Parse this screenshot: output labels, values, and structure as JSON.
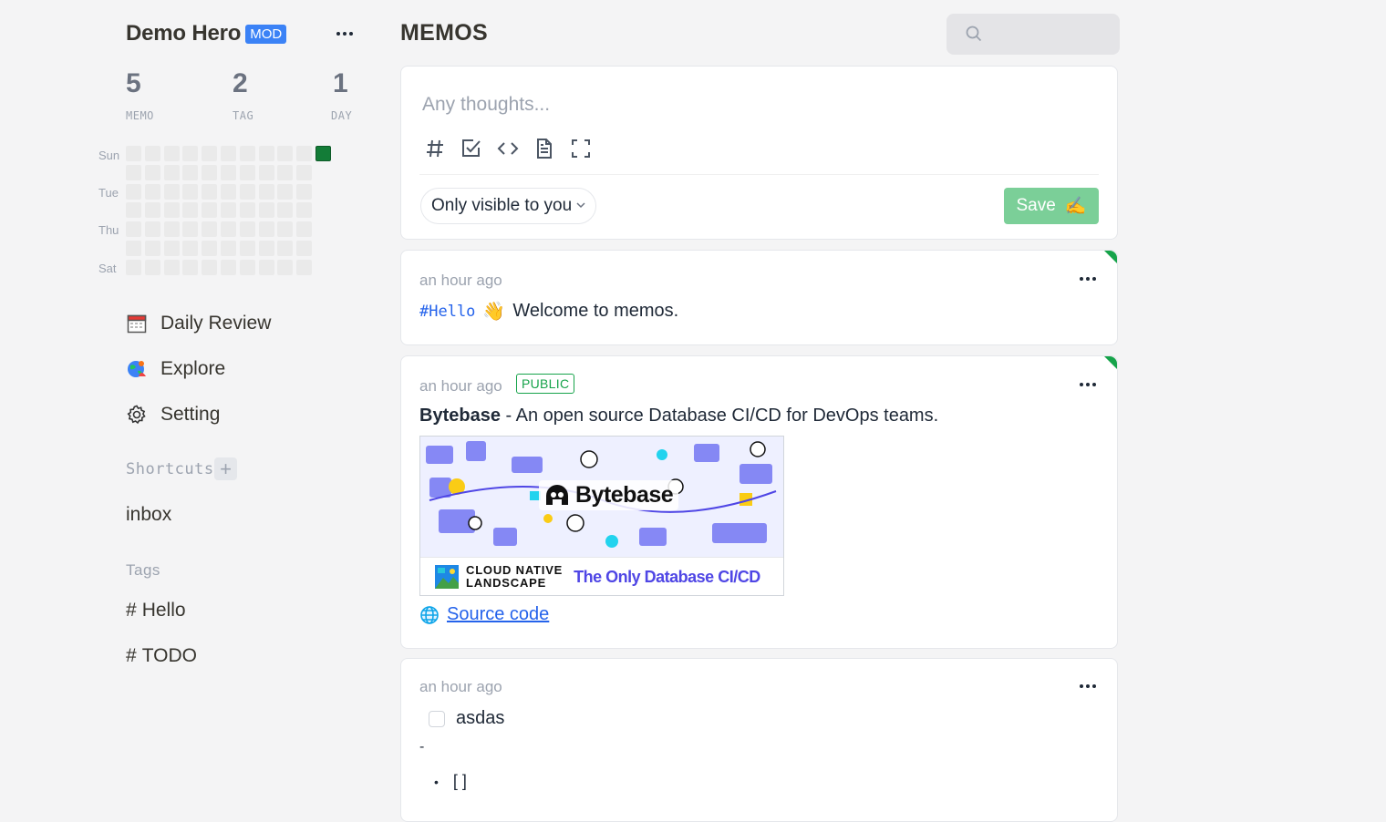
{
  "user": {
    "name": "Demo Hero",
    "role_badge": "MOD"
  },
  "stats": [
    {
      "value": "5",
      "label": "MEMO"
    },
    {
      "value": "2",
      "label": "TAG"
    },
    {
      "value": "1",
      "label": "DAY"
    }
  ],
  "heatmap": {
    "day_labels": [
      "Sun",
      "Tue",
      "Thu",
      "Sat"
    ],
    "active_color": "#137c37"
  },
  "nav": {
    "daily_review": "Daily Review",
    "explore": "Explore",
    "setting": "Setting"
  },
  "shortcuts": {
    "title": "Shortcuts",
    "items": [
      "inbox"
    ]
  },
  "tags": {
    "title": "Tags",
    "items": [
      "Hello",
      "TODO"
    ]
  },
  "header": {
    "title": "MEMOS"
  },
  "editor": {
    "placeholder": "Any thoughts...",
    "visibility": "Only visible to you",
    "save_label": "Save",
    "save_emoji": "✍️"
  },
  "memos": [
    {
      "time": "an hour ago",
      "tag": "#Hello",
      "emoji": "👋",
      "text": "Welcome to memos."
    },
    {
      "time": "an hour ago",
      "badge": "PUBLIC",
      "title": "Bytebase",
      "text": " - An open source Database CI/CD for DevOps teams.",
      "image": {
        "brand": "Bytebase",
        "footer_logo_line1": "CLOUD NATIVE",
        "footer_logo_line2": "LANDSCAPE",
        "footer_tagline": "The Only Database CI/CD"
      },
      "link": "Source code"
    },
    {
      "time": "an hour ago",
      "checkbox_text": "asdas",
      "dash": "-",
      "bullet": "[ ]"
    }
  ],
  "colors": {
    "accent": "#3b82f6",
    "public": "#16a34a",
    "save": "#7bcf98",
    "link": "#2563eb"
  }
}
